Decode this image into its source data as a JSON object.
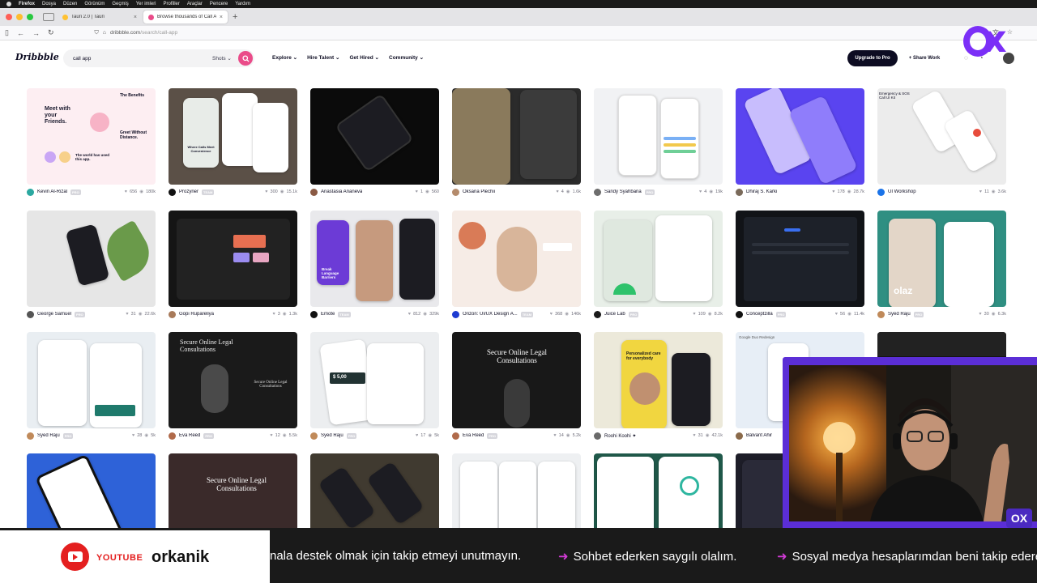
{
  "menubar": {
    "items": [
      "Firefox",
      "Dosya",
      "Düzen",
      "Görünüm",
      "Geçmiş",
      "Yer imleri",
      "Profiller",
      "Araçlar",
      "Pencere",
      "Yardım"
    ]
  },
  "tabs": [
    {
      "title": "Tauri 2.0 | Tauri",
      "active": false
    },
    {
      "title": "Browse thousands of Call App d",
      "active": true
    }
  ],
  "urlbar": {
    "host": "dribbble.com",
    "path": "/search/call-app"
  },
  "header": {
    "logo": "Dribbble",
    "search_value": "call app",
    "search_scope": "Shots",
    "nav": [
      "Explore",
      "Hire Talent",
      "Get Hired",
      "Community"
    ],
    "upgrade_label": "Upgrade to Pro",
    "share_label": "Share Work"
  },
  "shots": [
    {
      "author": "Kevin Al-Rizal",
      "badge": "PRO",
      "likes": "656",
      "views": "180k",
      "thumb_bg": "#fdeef2",
      "avatar": "#2ba8a0"
    },
    {
      "author": "Prozyner",
      "badge": "TEAM",
      "likes": "300",
      "views": "15.1k",
      "thumb_bg": "#5b5047",
      "avatar": "#111111"
    },
    {
      "author": "Anastasia Ananeva",
      "badge": "",
      "likes": "1",
      "views": "560",
      "thumb_bg": "#0b0b0b",
      "avatar": "#8a5a44"
    },
    {
      "author": "Oksana Plechii",
      "badge": "",
      "likes": "4",
      "views": "1.6k",
      "thumb_bg": "#2b2b2b",
      "avatar": "#b48b6c"
    },
    {
      "author": "Sandy Syahbana",
      "badge": "PRO",
      "likes": "4",
      "views": "19k",
      "thumb_bg": "#f1f2f4",
      "avatar": "#6d6d6d"
    },
    {
      "author": "Dhiraj S. Karki",
      "badge": "",
      "likes": "178",
      "views": "28.7k",
      "thumb_bg": "#5a44f0",
      "avatar": "#7a6a5a"
    },
    {
      "author": "UI Workshop",
      "badge": "",
      "likes": "11",
      "views": "3.6k",
      "thumb_bg": "#ececec",
      "avatar": "#1a73e8"
    },
    {
      "author": "George Samuel",
      "badge": "PRO",
      "likes": "31",
      "views": "22.6k",
      "thumb_bg": "#e6e6e6",
      "avatar": "#555555"
    },
    {
      "author": "Gopi Rupareliya",
      "badge": "",
      "likes": "3",
      "views": "1.3k",
      "thumb_bg": "#151515",
      "avatar": "#a87a5a"
    },
    {
      "author": "Emote",
      "badge": "TEAM",
      "likes": "812",
      "views": "329k",
      "thumb_bg": "#e9e9ec",
      "avatar": "#111111"
    },
    {
      "author": "Orizon: UI/UX Design A...",
      "badge": "TEAM",
      "likes": "368",
      "views": "146k",
      "thumb_bg": "#f6ece6",
      "avatar": "#1d3bd1"
    },
    {
      "author": "Juice Lab",
      "badge": "PRO",
      "likes": "109",
      "views": "8.2k",
      "thumb_bg": "#e8efe8",
      "avatar": "#1a1a1a"
    },
    {
      "author": "Conceptzilla",
      "badge": "PRO",
      "likes": "56",
      "views": "11.4k",
      "thumb_bg": "#111317",
      "avatar": "#111111"
    },
    {
      "author": "Syed Raju",
      "badge": "PRO",
      "likes": "30",
      "views": "6.3k",
      "thumb_bg": "#2f8f82",
      "avatar": "#c08a5a"
    },
    {
      "author": "Syed Raju",
      "badge": "PRO",
      "likes": "28",
      "views": "5k",
      "thumb_bg": "#e9eef2",
      "avatar": "#c08a5a"
    },
    {
      "author": "Eva Reed",
      "badge": "PRO",
      "likes": "12",
      "views": "5.5k",
      "thumb_bg": "#1a1a1a",
      "avatar": "#b06a4a"
    },
    {
      "author": "Syed Raju",
      "badge": "PRO",
      "likes": "17",
      "views": "5k",
      "thumb_bg": "#eceef0",
      "avatar": "#c08a5a"
    },
    {
      "author": "Eva Reed",
      "badge": "PRO",
      "likes": "14",
      "views": "5.2k",
      "thumb_bg": "#181818",
      "avatar": "#b06a4a"
    },
    {
      "author": "Roohi Koohi ✦",
      "badge": "",
      "likes": "31",
      "views": "42.1k",
      "thumb_bg": "#ece9da",
      "avatar": "#6a6a6a"
    },
    {
      "author": "Balvant Ahir",
      "badge": "",
      "likes": "",
      "views": "",
      "thumb_bg": "#e7eef6",
      "avatar": "#8a6a4a"
    },
    {
      "author": "",
      "badge": "",
      "likes": "",
      "views": "",
      "thumb_bg": "#121212",
      "avatar": "#333333"
    },
    {
      "author": "",
      "badge": "",
      "likes": "",
      "views": "",
      "thumb_bg": "#2e62d8",
      "avatar": ""
    },
    {
      "author": "",
      "badge": "",
      "likes": "",
      "views": "",
      "thumb_bg": "#3a2a2a",
      "avatar": ""
    },
    {
      "author": "",
      "badge": "",
      "likes": "",
      "views": "",
      "thumb_bg": "#403a30",
      "avatar": ""
    },
    {
      "author": "",
      "badge": "",
      "likes": "",
      "views": "",
      "thumb_bg": "#eef0f2",
      "avatar": ""
    },
    {
      "author": "",
      "badge": "",
      "likes": "",
      "views": "",
      "thumb_bg": "#20594a",
      "avatar": ""
    },
    {
      "author": "",
      "badge": "",
      "likes": "",
      "views": "",
      "thumb_bg": "#1d1d28",
      "avatar": ""
    }
  ],
  "shot_texts": {
    "meet": "Meet with your Friends.",
    "benefits": "The Benefits",
    "greet": "Greet Without Distance.",
    "world": "The world has used this app.",
    "where": "Where Calls Meet Convenience",
    "break": "Break Language Barriers",
    "legal": "Secure Online Legal Consultations",
    "personalized": "Personalized care for everybody",
    "olaz": "olaz",
    "amount": "$ 5,00",
    "emergency": "Emergency & SOS Call UI Kit",
    "google_duo": "Google Duo Redesign"
  },
  "overlay": {
    "yt_label": "YOUTUBE",
    "channel": "orkanik",
    "ticker": [
      "nala destek olmak için takip etmeyi unutmayın.",
      "Sohbet ederken saygılı olalım.",
      "Sosyal medya hesaplarımdan beni takip ederek o"
    ],
    "mini_logo": "OX"
  },
  "colors": {
    "brand_pink": "#ea4c89",
    "overlay_purple": "#5b2ed6",
    "ticker_arrow": "#d23bd6",
    "youtube_red": "#e41f1f"
  }
}
